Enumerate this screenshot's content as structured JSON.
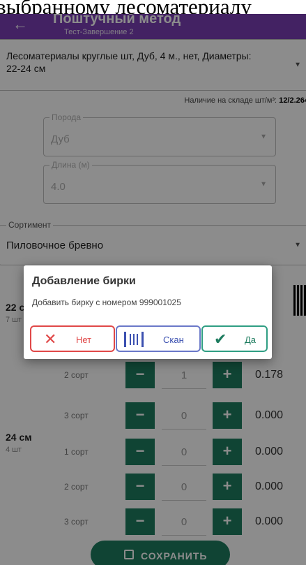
{
  "caption": "выбранному лесоматериалу",
  "header": {
    "title": "Поштучный метод",
    "subtitle": "Тест-Завершение 2"
  },
  "product": {
    "value": "Лесоматериалы круглые шт, Дуб, 4 м., нет, Диаметры: 22-24 см"
  },
  "stock": {
    "label": "Наличие на складе шт/м³:",
    "value": "12/2.264"
  },
  "species": {
    "label": "Порода",
    "value": "Дуб"
  },
  "length": {
    "label": "Длина (м)",
    "value": "4.0"
  },
  "assortment": {
    "label": "Сортимент",
    "value": "Пиловочное бревно"
  },
  "group_22": {
    "size": "22 см",
    "count": "7 шт"
  },
  "group_24": {
    "size": "24 см",
    "count": "4 шт"
  },
  "rows": [
    {
      "grade": "2 сорт",
      "qty": "1",
      "volume": "0.178"
    },
    {
      "grade": "3 сорт",
      "qty": "0",
      "volume": "0.000"
    },
    {
      "grade": "1 сорт",
      "qty": "0",
      "volume": "0.000"
    },
    {
      "grade": "2 сорт",
      "qty": "0",
      "volume": "0.000"
    },
    {
      "grade": "3 сорт",
      "qty": "0",
      "volume": "0.000"
    }
  ],
  "save_label": "СОХРАНИТЬ",
  "dialog": {
    "title": "Добавление бирки",
    "message": "Добавить бирку с номером 999001025",
    "no_label": "Нет",
    "scan_label": "Скан",
    "yes_label": "Да"
  },
  "icons": {
    "back": "arrow-left-icon",
    "dropdown": "chevron-down-icon",
    "save": "save-icon",
    "close": "close-icon",
    "barcode": "barcode-icon",
    "check": "check-icon"
  },
  "colors": {
    "primary": "#7b3fb4",
    "accent": "#1e7c5f",
    "danger": "#e04848",
    "scan": "#3b50b0"
  }
}
